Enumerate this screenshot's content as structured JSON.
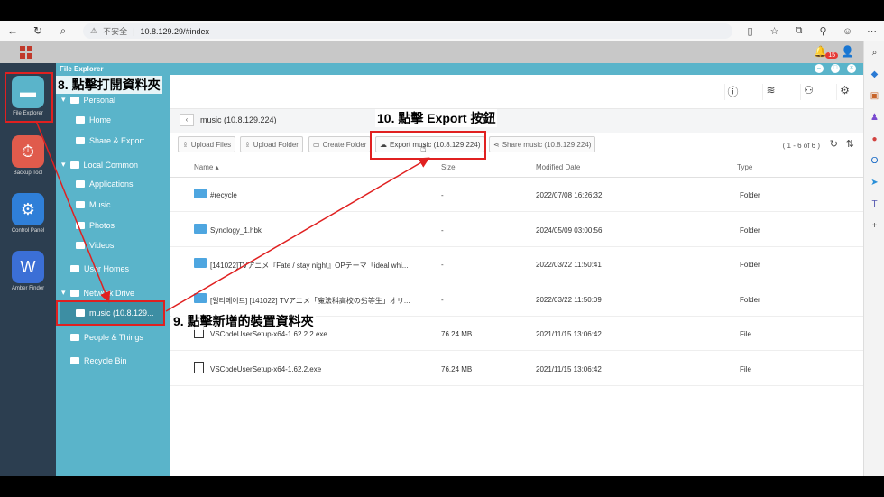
{
  "browser": {
    "security": "不安全",
    "url": "10.8.129.29/#index"
  },
  "nas": {
    "notifications": "15"
  },
  "dock": [
    {
      "label": "File Explorer",
      "color": "#5ab4ca",
      "glyph": "▬"
    },
    {
      "label": "Backup Tool",
      "color": "#e05b4c",
      "glyph": "⏱"
    },
    {
      "label": "Control Panel",
      "color": "#2f7fd8",
      "glyph": "⚙"
    },
    {
      "label": "Amber Finder",
      "color": "#3b6fd6",
      "glyph": "W"
    }
  ],
  "window": {
    "title": "File Explorer"
  },
  "sidebar": {
    "personal": "Personal",
    "home": "Home",
    "share_export": "Share & Export",
    "local_common": "Local Common",
    "applications": "Applications",
    "music": "Music",
    "photos": "Photos",
    "videos": "Videos",
    "user_homes": "User Homes",
    "network_drive": "Network Drive",
    "network_item": "music (10.8.129...",
    "people": "People & Things",
    "recycle": "Recycle Bin"
  },
  "breadcrumb": "music (10.8.129.224)",
  "actions": {
    "upload_files": "Upload Files",
    "upload_folder": "Upload Folder",
    "create_folder": "Create Folder",
    "export": "Export music (10.8.129.224)",
    "share": "Share music (10.8.129.224)"
  },
  "count": "( 1 - 6 of 6 )",
  "columns": {
    "name": "Name ▴",
    "size": "Size",
    "modified": "Modified Date",
    "type": "Type"
  },
  "rows": [
    {
      "name": "#recycle",
      "size": "-",
      "modified": "2022/07/08 16:26:32",
      "type": "Folder",
      "kind": "folder"
    },
    {
      "name": "Synology_1.hbk",
      "size": "-",
      "modified": "2024/05/09 03:00:56",
      "type": "Folder",
      "kind": "folder"
    },
    {
      "name": "[141022]TVアニメ『Fate / stay night』OPテーマ「ideal whi...",
      "size": "-",
      "modified": "2022/03/22 11:50:41",
      "type": "Folder",
      "kind": "folder"
    },
    {
      "name": "[얼티메이트] [141022] TVアニメ「魔法科高校の劣等生」オリ...",
      "size": "-",
      "modified": "2022/03/22 11:50:09",
      "type": "Folder",
      "kind": "folder"
    },
    {
      "name": "VSCodeUserSetup-x64-1.62.2 2.exe",
      "size": "76.24 MB",
      "modified": "2021/11/15 13:06:42",
      "type": "File",
      "kind": "file"
    },
    {
      "name": "VSCodeUserSetup-x64-1.62.2.exe",
      "size": "76.24 MB",
      "modified": "2021/11/15 13:06:42",
      "type": "File",
      "kind": "file"
    }
  ],
  "annotations": {
    "step8": "8. 點擊打開資料夾",
    "step9": "9. 點擊新增的裝置資料夾",
    "step10": "10. 點擊 Export 按鈕"
  }
}
